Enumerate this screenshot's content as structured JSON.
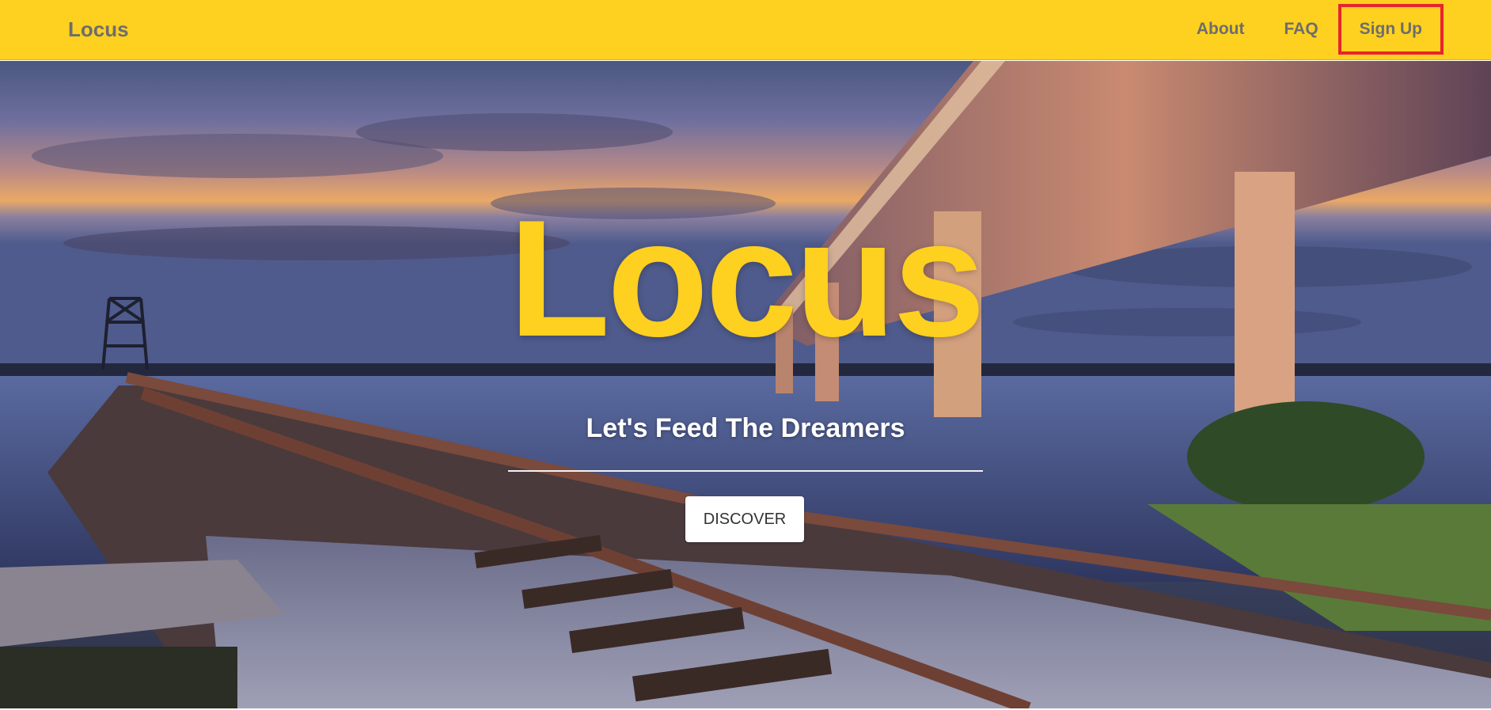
{
  "navbar": {
    "brand": "Locus",
    "links": [
      {
        "label": "About"
      },
      {
        "label": "FAQ"
      },
      {
        "label": "Sign Up"
      }
    ],
    "background_color": "#fed020",
    "highlight_color": "#e8242e"
  },
  "hero": {
    "title": "Locus",
    "subtitle": "Let's Feed The Dreamers",
    "button_label": "DISCOVER",
    "title_color": "#fed020"
  }
}
